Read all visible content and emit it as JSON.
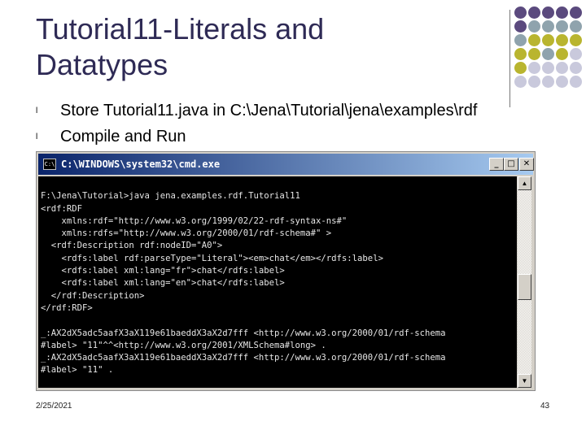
{
  "slide": {
    "title_line1": "Tutorial11-Literals and",
    "title_line2": "Datatypes",
    "bullets": [
      "Store Tutorial11.java in C:\\Jena\\Tutorial\\jena\\examples\\rdf",
      "Compile and Run"
    ],
    "bullet_marker": "l",
    "date": "2/25/2021",
    "page_number": "43"
  },
  "cmd_window": {
    "title": "C:\\WINDOWS\\system32\\cmd.exe",
    "icon_text": "C:\\",
    "minimize_glyph": "_",
    "maximize_glyph": "□",
    "close_glyph": "✕",
    "scroll_up_glyph": "▲",
    "scroll_down_glyph": "▼",
    "lines": [
      "",
      "F:\\Jena\\Tutorial>java jena.examples.rdf.Tutorial11",
      "<rdf:RDF",
      "    xmlns:rdf=\"http://www.w3.org/1999/02/22-rdf-syntax-ns#\"",
      "    xmlns:rdfs=\"http://www.w3.org/2000/01/rdf-schema#\" >",
      "  <rdf:Description rdf:nodeID=\"A0\">",
      "    <rdfs:label rdf:parseType=\"Literal\"><em>chat</em></rdfs:label>",
      "    <rdfs:label xml:lang=\"fr\">chat</rdfs:label>",
      "    <rdfs:label xml:lang=\"en\">chat</rdfs:label>",
      "  </rdf:Description>",
      "</rdf:RDF>",
      "",
      "_:AX2dX5adc5aafX3aX119e61baeddX3aX2d7fff <http://www.w3.org/2000/01/rdf-schema",
      "#label> \"11\"^^<http://www.w3.org/2001/XMLSchema#long> .",
      "_:AX2dX5adc5aafX3aX119e61baeddX3aX2d7fff <http://www.w3.org/2000/01/rdf-schema",
      "#label> \"11\" ."
    ]
  },
  "colors": {
    "title": "#2e2a55",
    "dot_purple": "#5b4a7e",
    "dot_teal": "#8fa3ad",
    "dot_olive": "#b9b52f",
    "dot_lavender": "#c9c9dc"
  },
  "decoration_dots": [
    [
      "purple",
      "purple",
      "purple",
      "purple",
      "purple"
    ],
    [
      "purple",
      "teal",
      "teal",
      "teal",
      "teal"
    ],
    [
      "teal",
      "olive",
      "olive",
      "olive",
      "olive"
    ],
    [
      "olive",
      "olive",
      "teal",
      "olive",
      "lavender"
    ],
    [
      "olive",
      "lavender",
      "lavender",
      "lavender",
      "lavender"
    ],
    [
      "lavender",
      "lavender",
      "lavender",
      "lavender",
      "lavender"
    ]
  ]
}
